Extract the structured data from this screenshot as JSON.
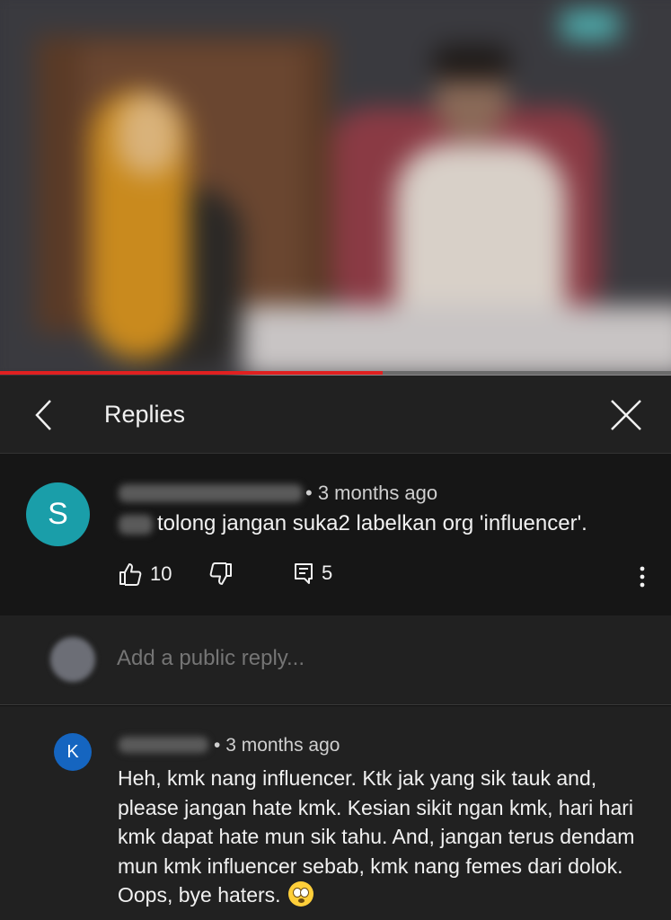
{
  "video": {
    "progress": 0.57,
    "colors": {
      "progress_fill": "#e02020",
      "progress_track": "#6b6b6b"
    }
  },
  "header": {
    "title": "Replies",
    "back_icon": "chevron-left-icon",
    "close_icon": "close-icon"
  },
  "comment": {
    "avatar_letter": "S",
    "avatar_color": "#1a9ea9",
    "time": "3 months ago",
    "text": "tolong jangan suka2 labelkan org 'influencer'.",
    "likes": "10",
    "replies": "5"
  },
  "reply_input": {
    "placeholder": "Add a public reply..."
  },
  "reply": {
    "avatar_letter": "K",
    "avatar_color": "#1565c0",
    "time": "3 months ago",
    "text": "Heh, kmk nang influencer. Ktk jak yang sik tauk and, please jangan hate kmk. Kesian sikit ngan kmk, hari hari kmk dapat hate mun sik tahu. And, jangan terus dendam mun kmk influencer sebab, kmk nang femes dari dolok. Oops, bye haters.",
    "emoji": "eye-roll-emoji"
  }
}
